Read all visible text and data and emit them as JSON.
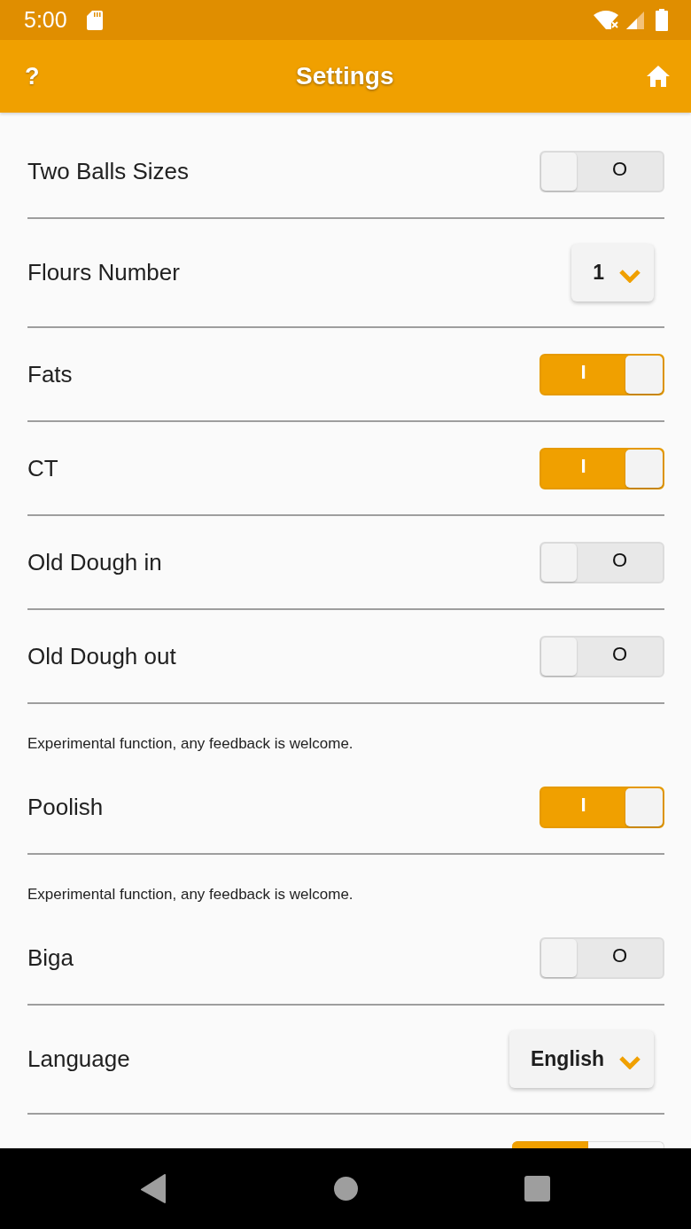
{
  "status_bar": {
    "time": "5:00"
  },
  "app_bar": {
    "help": "?",
    "title": "Settings"
  },
  "settings": [
    {
      "kind": "toggle",
      "label": "Two Balls Sizes",
      "on": false,
      "text": "O"
    },
    {
      "kind": "dropdown",
      "label": "Flours Number",
      "value": "1"
    },
    {
      "kind": "toggle",
      "label": "Fats",
      "on": true,
      "text": "I"
    },
    {
      "kind": "toggle",
      "label": "CT",
      "on": true,
      "text": "I"
    },
    {
      "kind": "toggle",
      "label": "Old Dough in",
      "on": false,
      "text": "O"
    },
    {
      "kind": "toggle",
      "label": "Old Dough out",
      "on": false,
      "text": "O"
    },
    {
      "kind": "note",
      "text": "Experimental function, any feedback is welcome."
    },
    {
      "kind": "toggle",
      "label": "Poolish",
      "on": true,
      "text": "I"
    },
    {
      "kind": "note",
      "text": "Experimental function, any feedback is welcome."
    },
    {
      "kind": "toggle",
      "label": "Biga",
      "on": false,
      "text": "O"
    },
    {
      "kind": "dropdown",
      "label": "Language",
      "value": "English"
    },
    {
      "kind": "segmented",
      "segments": [
        {
          "selected": true
        },
        {
          "selected": false
        }
      ]
    }
  ]
}
